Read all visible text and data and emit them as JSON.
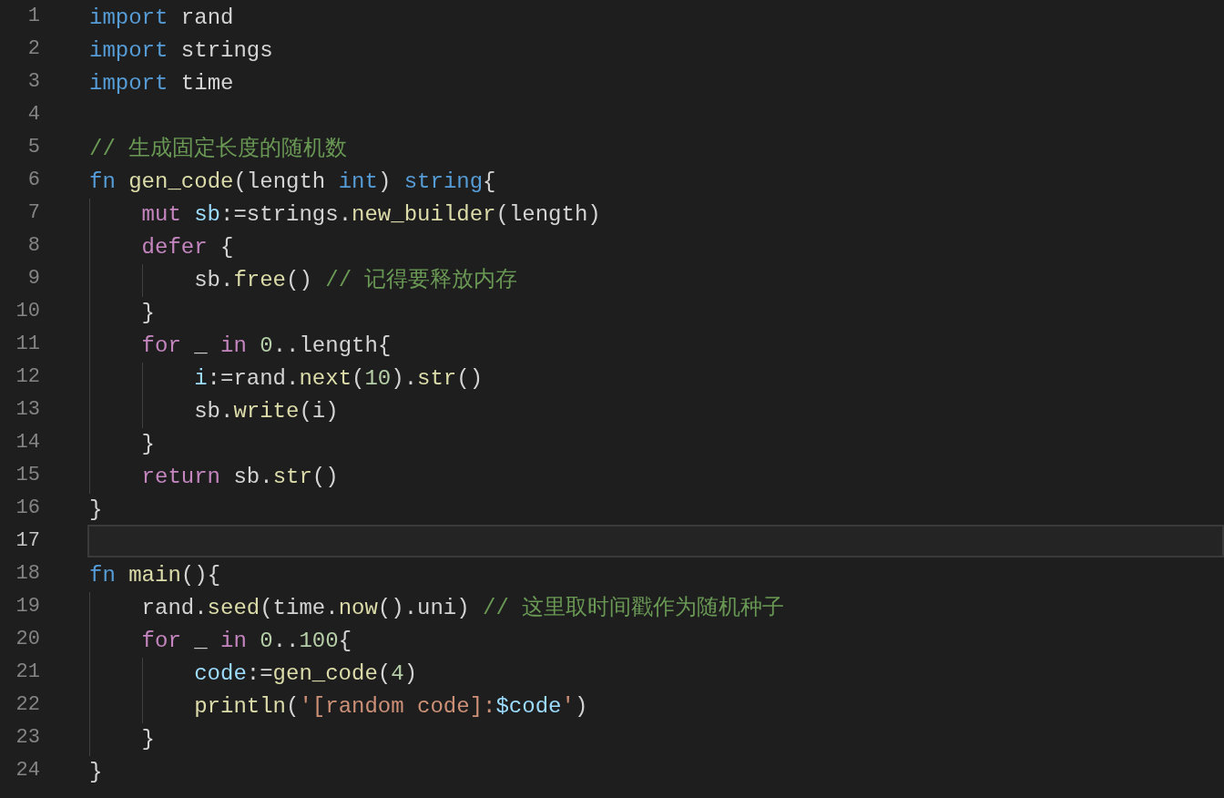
{
  "editor": {
    "lines": [
      {
        "number": "1",
        "selected": false,
        "tokens": [
          {
            "kind": "keyword",
            "text": "import"
          },
          {
            "kind": "plain",
            "text": " rand"
          }
        ]
      },
      {
        "number": "2",
        "selected": false,
        "tokens": [
          {
            "kind": "keyword",
            "text": "import"
          },
          {
            "kind": "plain",
            "text": " strings"
          }
        ]
      },
      {
        "number": "3",
        "selected": false,
        "tokens": [
          {
            "kind": "keyword",
            "text": "import"
          },
          {
            "kind": "plain",
            "text": " time"
          }
        ]
      },
      {
        "number": "4",
        "selected": false
      },
      {
        "number": "5",
        "selected": false,
        "tokens": [
          {
            "kind": "comment",
            "text": "// 生成固定长度的随机数"
          }
        ]
      },
      {
        "number": "6",
        "selected": false,
        "tokens": [
          {
            "kind": "keyword",
            "text": "fn"
          },
          {
            "kind": "function",
            "text": " gen_code"
          },
          {
            "kind": "plain",
            "text": "(length "
          },
          {
            "kind": "keyword",
            "text": "int"
          },
          {
            "kind": "plain",
            "text": ") "
          },
          {
            "kind": "keyword",
            "text": "string"
          },
          {
            "kind": "plain",
            "text": "{"
          }
        ],
        "children": [
          {
            "number": "7",
            "selected": false,
            "tokens": [
              {
                "kind": "control",
                "text": "mut"
              },
              {
                "kind": "variable",
                "text": " sb"
              },
              {
                "kind": "plain",
                "text": ":=strings."
              },
              {
                "kind": "function",
                "text": "new_builder"
              },
              {
                "kind": "plain",
                "text": "(length)"
              }
            ]
          },
          {
            "number": "8",
            "selected": false,
            "tokens": [
              {
                "kind": "control",
                "text": "defer"
              },
              {
                "kind": "plain",
                "text": " {"
              }
            ],
            "children": [
              {
                "number": "9",
                "selected": false,
                "tokens": [
                  {
                    "kind": "plain",
                    "text": "sb."
                  },
                  {
                    "kind": "function",
                    "text": "free"
                  },
                  {
                    "kind": "plain",
                    "text": "() "
                  },
                  {
                    "kind": "comment",
                    "text": "// 记得要释放内存"
                  }
                ]
              }
            ]
          },
          {
            "number": "10",
            "selected": false,
            "tokens": [
              {
                "kind": "plain",
                "text": "}"
              }
            ]
          },
          {
            "number": "11",
            "selected": false,
            "tokens": [
              {
                "kind": "control",
                "text": "for"
              },
              {
                "kind": "plain",
                "text": " _ "
              },
              {
                "kind": "control",
                "text": "in"
              },
              {
                "kind": "number",
                "text": " 0"
              },
              {
                "kind": "plain",
                "text": "..length{"
              }
            ],
            "children": [
              {
                "number": "12",
                "selected": false,
                "tokens": [
                  {
                    "kind": "variable",
                    "text": "i"
                  },
                  {
                    "kind": "plain",
                    "text": ":=rand."
                  },
                  {
                    "kind": "function",
                    "text": "next"
                  },
                  {
                    "kind": "plain",
                    "text": "("
                  },
                  {
                    "kind": "number",
                    "text": "10"
                  },
                  {
                    "kind": "plain",
                    "text": ")."
                  },
                  {
                    "kind": "function",
                    "text": "str"
                  },
                  {
                    "kind": "plain",
                    "text": "()"
                  }
                ]
              },
              {
                "number": "13",
                "selected": false,
                "tokens": [
                  {
                    "kind": "plain",
                    "text": "sb."
                  },
                  {
                    "kind": "function",
                    "text": "write"
                  },
                  {
                    "kind": "plain",
                    "text": "(i)"
                  }
                ]
              }
            ]
          },
          {
            "number": "14",
            "selected": false,
            "tokens": [
              {
                "kind": "plain",
                "text": "}"
              }
            ]
          },
          {
            "number": "15",
            "selected": false,
            "tokens": [
              {
                "kind": "control",
                "text": "return"
              },
              {
                "kind": "plain",
                "text": " sb."
              },
              {
                "kind": "function",
                "text": "str"
              },
              {
                "kind": "plain",
                "text": "()"
              }
            ]
          }
        ]
      },
      {
        "number": "16",
        "selected": false,
        "tokens": [
          {
            "kind": "plain",
            "text": "}"
          }
        ]
      },
      {
        "number": "17",
        "selected": true
      },
      {
        "number": "18",
        "selected": false,
        "tokens": [
          {
            "kind": "keyword",
            "text": "fn"
          },
          {
            "kind": "function",
            "text": " main"
          },
          {
            "kind": "plain",
            "text": "(){"
          }
        ],
        "children": [
          {
            "number": "19",
            "selected": false,
            "tokens": [
              {
                "kind": "plain",
                "text": "rand."
              },
              {
                "kind": "function",
                "text": "seed"
              },
              {
                "kind": "plain",
                "text": "(time."
              },
              {
                "kind": "function",
                "text": "now"
              },
              {
                "kind": "plain",
                "text": "().uni) "
              },
              {
                "kind": "comment",
                "text": "// 这里取时间戳作为随机种子"
              }
            ]
          },
          {
            "number": "20",
            "selected": false,
            "tokens": [
              {
                "kind": "control",
                "text": "for"
              },
              {
                "kind": "plain",
                "text": " _ "
              },
              {
                "kind": "control",
                "text": "in"
              },
              {
                "kind": "number",
                "text": " 0"
              },
              {
                "kind": "plain",
                "text": ".."
              },
              {
                "kind": "number",
                "text": "100"
              },
              {
                "kind": "plain",
                "text": "{"
              }
            ],
            "children": [
              {
                "number": "21",
                "selected": false,
                "tokens": [
                  {
                    "kind": "variable",
                    "text": "code"
                  },
                  {
                    "kind": "plain",
                    "text": ":="
                  },
                  {
                    "kind": "function",
                    "text": "gen_code"
                  },
                  {
                    "kind": "plain",
                    "text": "("
                  },
                  {
                    "kind": "number",
                    "text": "4"
                  },
                  {
                    "kind": "plain",
                    "text": ")"
                  }
                ]
              },
              {
                "number": "22",
                "selected": false,
                "tokens": [
                  {
                    "kind": "function",
                    "text": "println"
                  },
                  {
                    "kind": "plain",
                    "text": "("
                  },
                  {
                    "kind": "string",
                    "text": "'[random code]:"
                  },
                  {
                    "kind": "variable",
                    "text": "$code"
                  },
                  {
                    "kind": "string",
                    "text": "'"
                  },
                  {
                    "kind": "plain",
                    "text": ")"
                  }
                ]
              }
            ]
          },
          {
            "number": "23",
            "selected": false,
            "tokens": [
              {
                "kind": "plain",
                "text": "}"
              }
            ]
          }
        ]
      },
      {
        "number": "24",
        "selected": false,
        "tokens": [
          {
            "kind": "plain",
            "text": "}"
          }
        ]
      }
    ]
  }
}
